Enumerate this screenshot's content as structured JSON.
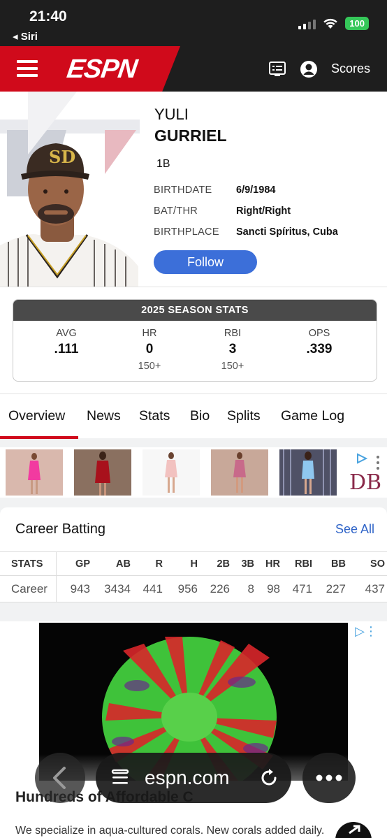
{
  "status_bar": {
    "time": "21:40",
    "back_label": "◂ Siri",
    "battery": "100"
  },
  "header": {
    "logo": "ESPN",
    "scores_label": "Scores"
  },
  "player": {
    "first_name": "YULI",
    "last_name": "GURRIEL",
    "position": "1B",
    "info": [
      {
        "label": "BIRTHDATE",
        "value": "6/9/1984"
      },
      {
        "label": "BAT/THR",
        "value": "Right/Right"
      },
      {
        "label": "BIRTHPLACE",
        "value": "Sancti Spíritus, Cuba"
      }
    ],
    "follow_label": "Follow"
  },
  "season_stats": {
    "title": "2025 SEASON STATS",
    "stats": [
      {
        "label": "AVG",
        "value": ".111",
        "rank": ""
      },
      {
        "label": "HR",
        "value": "0",
        "rank": "150+"
      },
      {
        "label": "RBI",
        "value": "3",
        "rank": "150+"
      },
      {
        "label": "OPS",
        "value": ".339",
        "rank": ""
      }
    ]
  },
  "tabs": [
    "Overview",
    "News",
    "Stats",
    "Bio",
    "Splits",
    "Game Log"
  ],
  "career": {
    "title": "Career Batting",
    "see_all": "See All",
    "headers": [
      "STATS",
      "GP",
      "AB",
      "R",
      "H",
      "2B",
      "3B",
      "HR",
      "RBI",
      "BB",
      "SO"
    ],
    "row": [
      "Career",
      "943",
      "3434",
      "441",
      "956",
      "226",
      "8",
      "98",
      "471",
      "227",
      "437"
    ]
  },
  "bottom_ad": {
    "headline": "Hundreds of Affordable C",
    "body": "We specialize in aqua-cultured corals. New corals added daily."
  },
  "browser": {
    "url": "espn.com"
  },
  "colors": {
    "espn_red": "#d00a1b",
    "follow_blue": "#3c6fd9",
    "link_blue": "#2f64c8"
  }
}
